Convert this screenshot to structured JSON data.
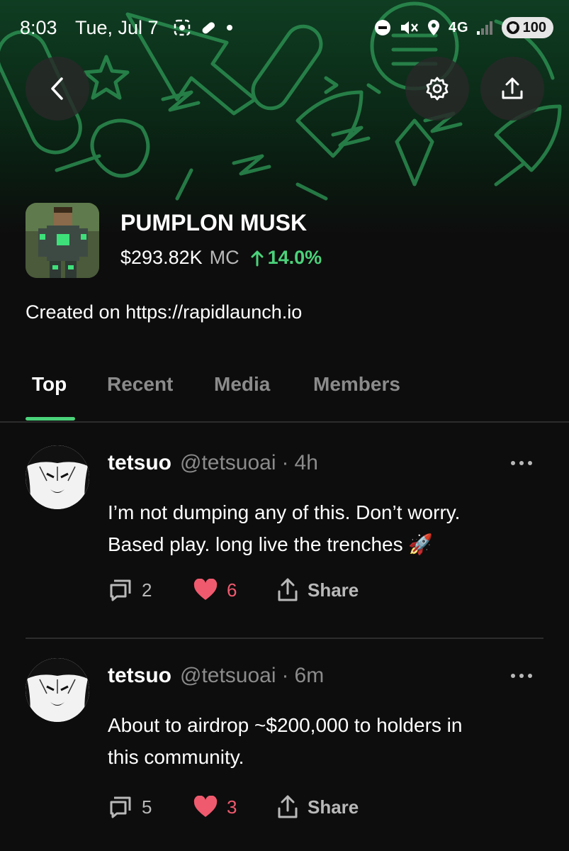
{
  "status_bar": {
    "time": "8:03",
    "date": "Tue, Jul 7",
    "network": "4G",
    "battery": "100"
  },
  "header": {
    "back_icon": "chevron-left-icon",
    "settings_icon": "gear-icon",
    "share_icon": "upload-icon"
  },
  "community": {
    "name": "PUMPLON MUSK",
    "market_cap": "$293.82K",
    "market_cap_label": "MC",
    "change": "14.0%",
    "change_direction": "up",
    "description": "Created on https://rapidlaunch.io"
  },
  "tabs": [
    {
      "label": "Top",
      "active": true
    },
    {
      "label": "Recent",
      "active": false
    },
    {
      "label": "Media",
      "active": false
    },
    {
      "label": "Members",
      "active": false
    }
  ],
  "posts": [
    {
      "author": "tetsuo",
      "handle": "@tetsuoai",
      "separator": "·",
      "time": "4h",
      "text_line1": "I’m not dumping any of this. Don’t worry.",
      "text_line2": "Based play. long live the trenches 🚀",
      "replies": "2",
      "likes": "6",
      "share_label": "Share"
    },
    {
      "author": "tetsuo",
      "handle": "@tetsuoai",
      "separator": "·",
      "time": "6m",
      "text_line1": "About to airdrop ~$200,000 to holders in",
      "text_line2": "this community.",
      "replies": "5",
      "likes": "3",
      "share_label": "Share"
    }
  ],
  "colors": {
    "accent_green": "#4bd27a",
    "like_red": "#f05a6e",
    "background": "#0d0d0d",
    "muted_text": "#8b8b8b"
  }
}
